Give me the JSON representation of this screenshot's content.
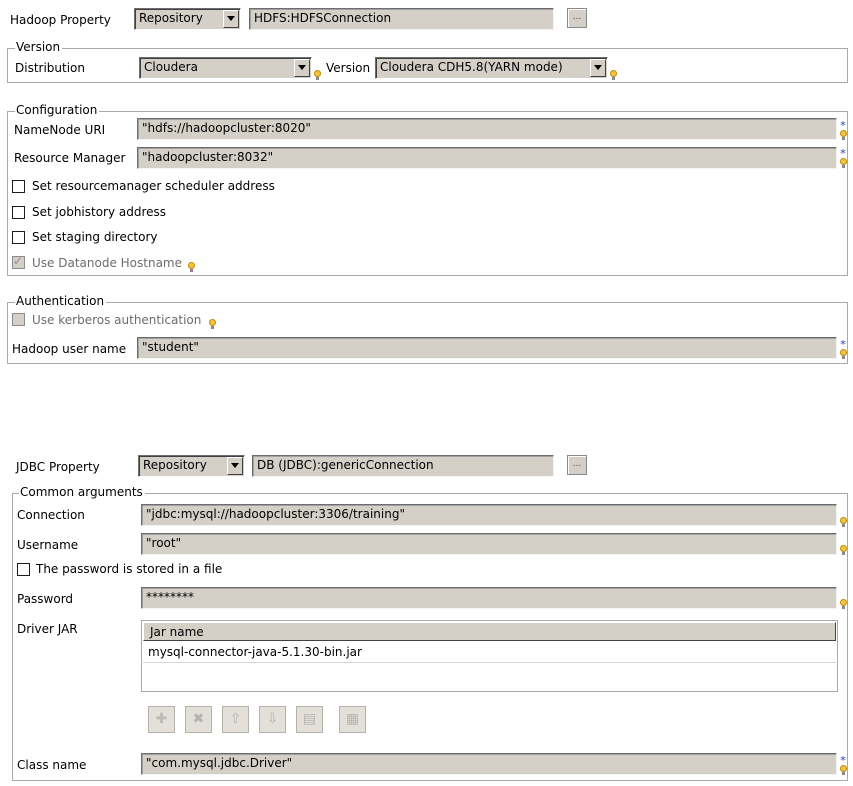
{
  "hadoop": {
    "property_label": "Hadoop Property",
    "property_value": "Repository",
    "connection_value": "HDFS:HDFSConnection",
    "dots": "...",
    "version_legend": "Version",
    "distribution_label": "Distribution",
    "distribution_value": "Cloudera",
    "version_label": "Version",
    "version_value": "Cloudera CDH5.8(YARN mode)",
    "config_legend": "Configuration",
    "namenode_label": "NameNode URI",
    "namenode_value": "\"hdfs://hadoopcluster:8020\"",
    "rm_label": "Resource Manager",
    "rm_value": "\"hadoopcluster:8032\"",
    "cb_rm_scheduler": "Set resourcemanager scheduler address",
    "cb_jobhistory": "Set jobhistory address",
    "cb_staging": "Set staging directory",
    "cb_datanode": "Use Datanode Hostname",
    "auth_legend": "Authentication",
    "cb_kerberos": "Use kerberos authentication",
    "user_label": "Hadoop user name",
    "user_value": "\"student\""
  },
  "jdbc": {
    "property_label": "JDBC Property",
    "property_value": "Repository",
    "connection_value": "DB (JDBC):genericConnection",
    "dots": "...",
    "common_legend": "Common arguments",
    "connection_label": "Connection",
    "connection_url": "\"jdbc:mysql://hadoopcluster:3306/training\"",
    "username_label": "Username",
    "username_value": "\"root\"",
    "cb_password_file": "The password is stored in a file",
    "password_label": "Password",
    "password_value": "********",
    "driver_label": "Driver JAR",
    "jar_header": "Jar name",
    "jar_rows": [
      "mysql-connector-java-5.1.30-bin.jar"
    ],
    "toolbar_icons": [
      "add-icon",
      "remove-icon",
      "move-up-icon",
      "move-down-icon",
      "copy-icon",
      "paste-icon"
    ],
    "classname_label": "Class name",
    "classname_value": "\"com.mysql.jdbc.Driver\""
  },
  "required_mark": "*"
}
